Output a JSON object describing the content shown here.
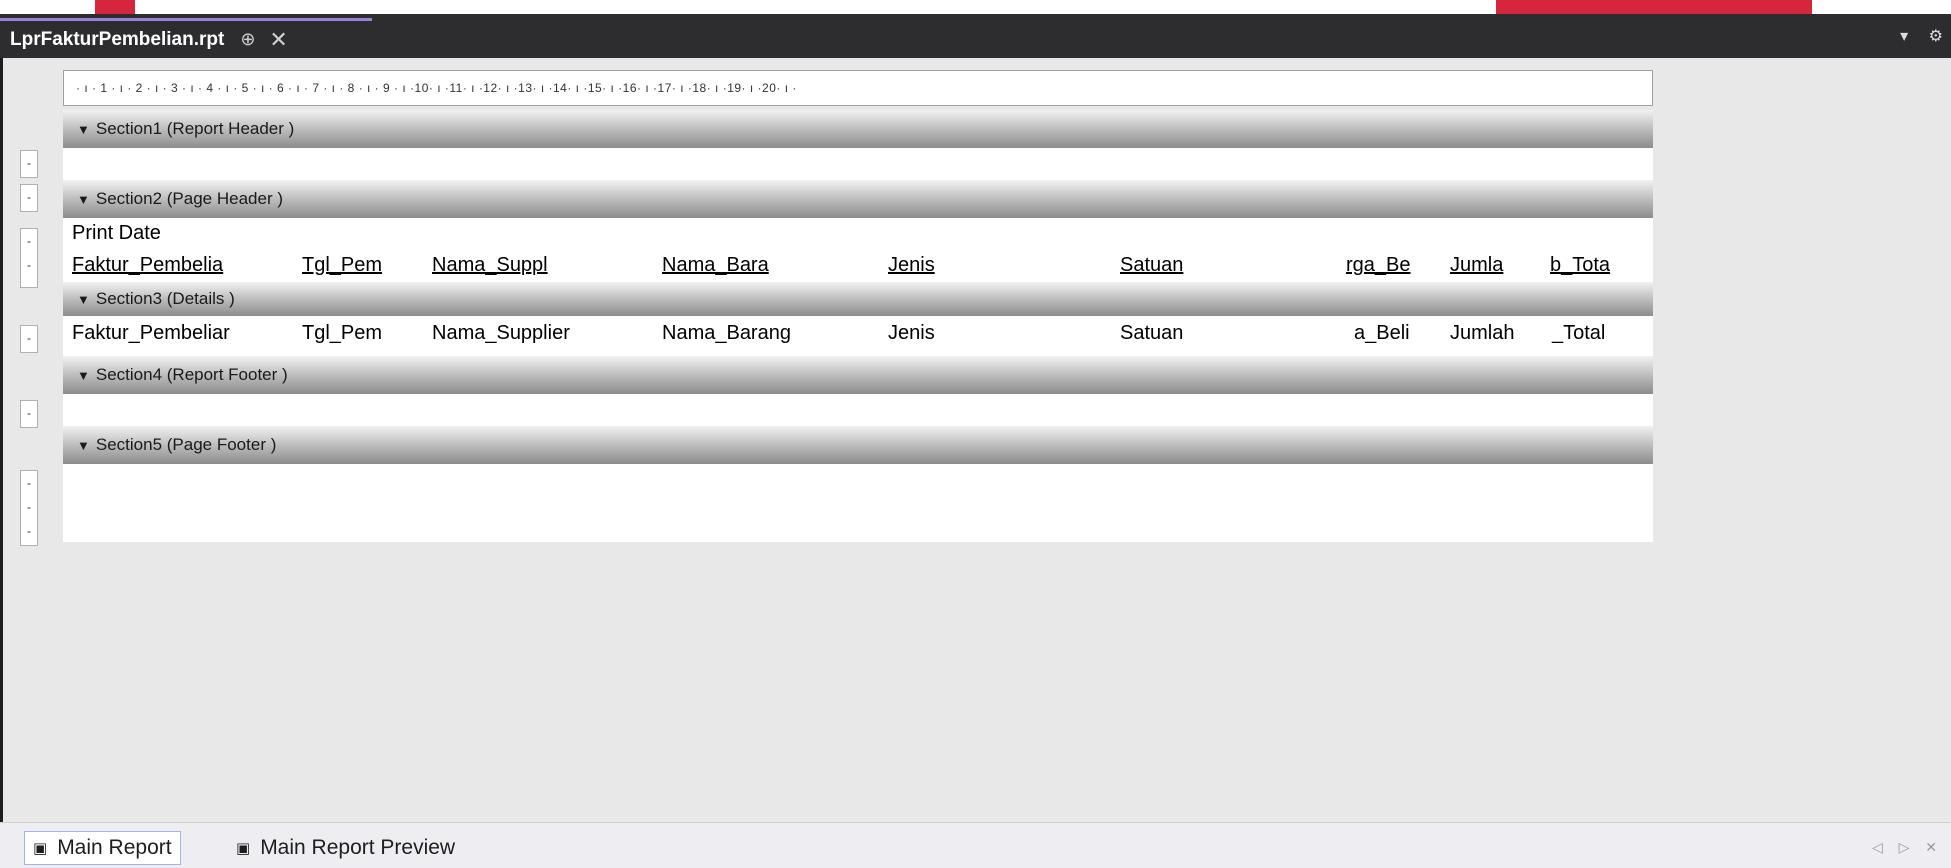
{
  "window": {
    "tab_title": "LprFakturPembelian.rpt",
    "pin_glyph": "⊕",
    "close_glyph": "✕",
    "dropdown_glyph": "▾",
    "settings_glyph": "⚙"
  },
  "ruler": {
    "text": "· ı · 1 · ı · 2 · ı · 3 · ı · 4 · ı · 5 · ı · 6 · ı · 7 · ı · 8 · ı · 9 · ı ·10· ı ·11· ı ·12· ı ·13· ı ·14· ı ·15· ı ·16· ı ·17· ı ·18· ı ·19· ı ·20· ı ·"
  },
  "sections": [
    {
      "label": "Section1 (Report Header )"
    },
    {
      "label": "Section2 (Page Header )"
    },
    {
      "label": "Section3 (Details )"
    },
    {
      "label": "Section4 (Report Footer )"
    },
    {
      "label": "Section5 (Page Footer )"
    }
  ],
  "page_header": {
    "print_date": "Print Date",
    "columns": [
      "Faktur_Pembelia",
      "Tgl_Pem",
      "Nama_Suppl",
      "Nama_Bara",
      "Jenis",
      "Satuan",
      "rga_Be",
      "Jumla",
      "b_Tota"
    ]
  },
  "details": {
    "fields": [
      "Faktur_Pembeliar",
      "Tgl_Pem",
      "Nama_Supplier",
      "Nama_Barang",
      "Jenis",
      "Satuan",
      "a_Beli",
      "Jumlah",
      "_Total"
    ]
  },
  "bottom_tabs": {
    "main_report": "Main Report",
    "main_report_preview": "Main Report Preview",
    "nav": "◁ ▷ ✕"
  }
}
